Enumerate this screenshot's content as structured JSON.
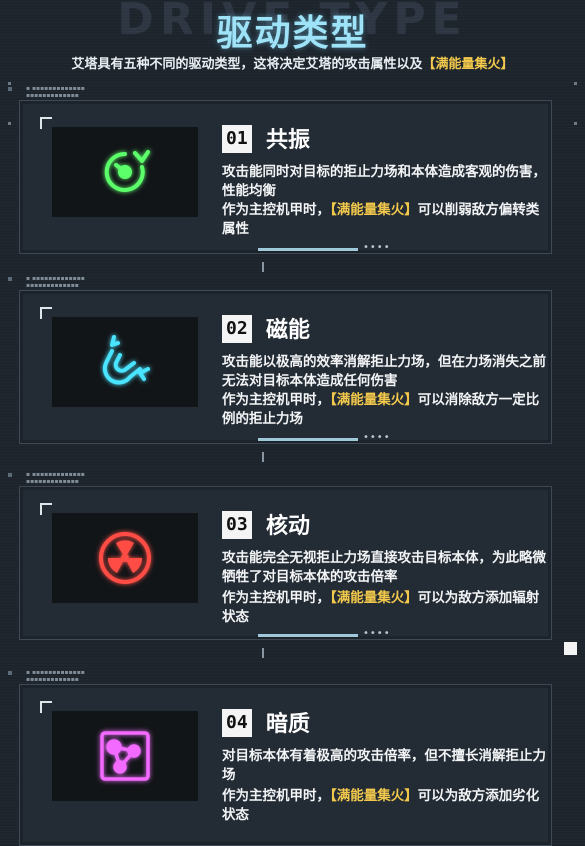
{
  "header": {
    "bg_word": "DRIVE TYPE",
    "title": "驱动类型",
    "subtitle_main": "艾塔具有五种不同的驱动类型，这将决定艾塔的攻击属性以及",
    "subtitle_highlight": "【满能量集火】"
  },
  "cards": [
    {
      "num": "01",
      "name": "共振",
      "icon": "resonance-icon",
      "color": "#36e04a",
      "desc": "攻击能同时对目标的拒止力场和本体造成客观的伤害，性能均衡",
      "note_prefix": "作为主控机甲时，",
      "note_highlight": "【满能量集火】",
      "note_suffix": "可以削弱敌方偏转类属性"
    },
    {
      "num": "02",
      "name": "磁能",
      "icon": "magnet-icon",
      "color": "#2fd6f2",
      "desc": "攻击能以极高的效率消解拒止力场，但在力场消失之前无法对目标本体造成任何伤害",
      "note_prefix": "作为主控机甲时，",
      "note_highlight": "【满能量集火】",
      "note_suffix": "可以消除敌方一定比例的拒止力场"
    },
    {
      "num": "03",
      "name": "核动",
      "icon": "radiation-icon",
      "color": "#f0403a",
      "desc": "攻击能完全无视拒止力场直接攻击目标本体，为此略微牺牲了对目标本体的攻击倍率",
      "note_prefix": "作为主控机甲时，",
      "note_highlight": "【满能量集火】",
      "note_suffix": "可以为敌方添加辐射状态"
    },
    {
      "num": "04",
      "name": "暗质",
      "icon": "dark-matter-icon",
      "color": "#e94bf0",
      "desc": "对目标本体有着极高的攻击倍率，但不擅长消解拒止力场",
      "note_prefix": "作为主控机甲时，",
      "note_highlight": "【满能量集火】",
      "note_suffix": "可以为敌方添加劣化状态"
    }
  ]
}
